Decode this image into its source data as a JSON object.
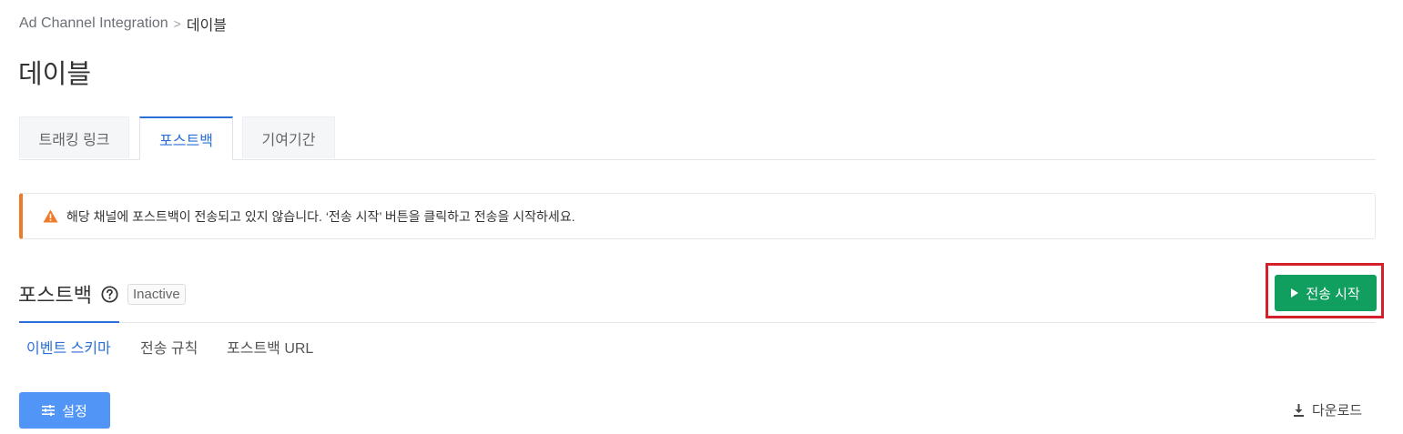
{
  "breadcrumb": {
    "parent": "Ad Channel Integration",
    "separator": ">",
    "current": "데이블"
  },
  "page_title": "데이블",
  "tabs": [
    {
      "label": "트래킹 링크"
    },
    {
      "label": "포스트백"
    },
    {
      "label": "기여기간"
    }
  ],
  "alert": {
    "message": "해당 채널에 포스트백이 전송되고 있지 않습니다. ‘전송 시작’ 버튼을 클릭하고 전송을 시작하세요.",
    "icon": "warning-triangle-icon",
    "color": "#ee7b2a"
  },
  "section": {
    "title": "포스트백",
    "status_badge": "Inactive",
    "help_icon": "question-circle-icon"
  },
  "start_button": {
    "label": "전송 시작",
    "icon": "play-icon",
    "color": "#119f5f"
  },
  "subtabs": [
    {
      "label": "이벤트 스키마"
    },
    {
      "label": "전송 규칙"
    },
    {
      "label": "포스트백 URL"
    }
  ],
  "settings_button": {
    "label": "설정",
    "icon": "sliders-icon",
    "color": "#5196f6"
  },
  "download": {
    "label": "다운로드",
    "icon": "download-icon"
  },
  "accent_color": "#2c6fd6"
}
